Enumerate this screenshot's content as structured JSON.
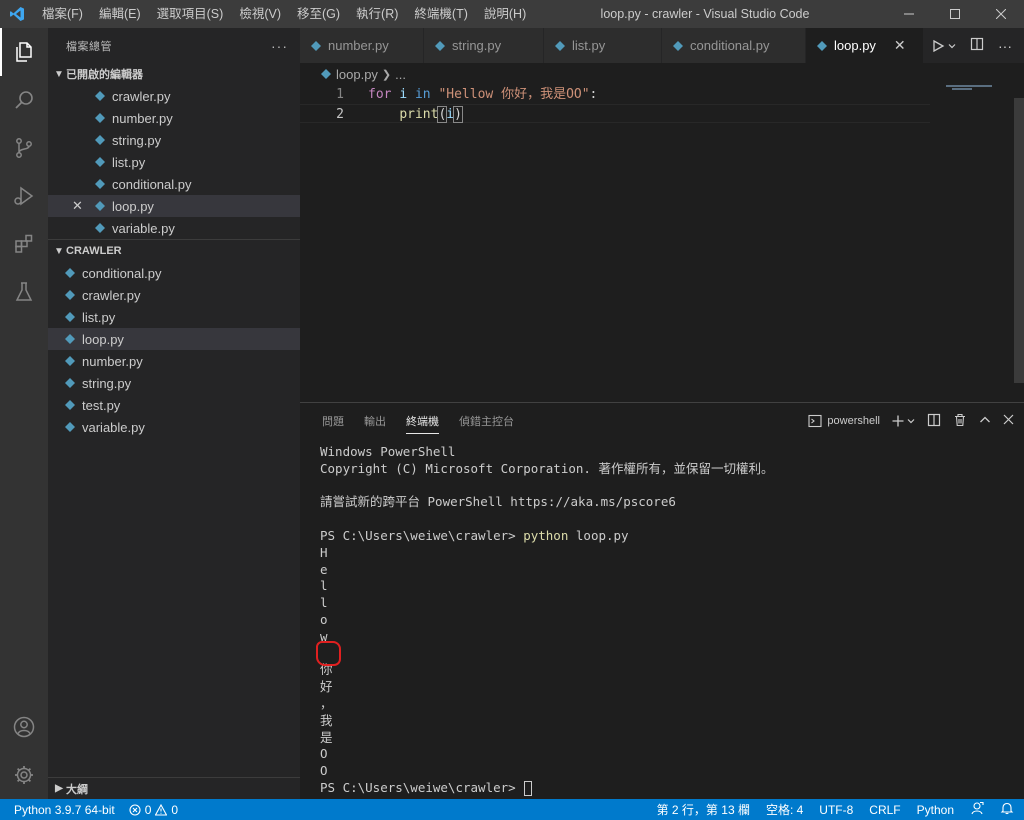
{
  "titlebar": {
    "menu": [
      "檔案(F)",
      "編輯(E)",
      "選取項目(S)",
      "檢視(V)",
      "移至(G)",
      "執行(R)",
      "終端機(T)",
      "說明(H)"
    ],
    "title": "loop.py - crawler - Visual Studio Code"
  },
  "sidebar": {
    "header": "檔案總管",
    "open_editors_title": "已開啟的編輯器",
    "open_editors": [
      "crawler.py",
      "number.py",
      "string.py",
      "list.py",
      "conditional.py",
      "loop.py",
      "variable.py"
    ],
    "folder_title": "CRAWLER",
    "folder_files": [
      "conditional.py",
      "crawler.py",
      "list.py",
      "loop.py",
      "number.py",
      "string.py",
      "test.py",
      "variable.py"
    ],
    "outline_title": "大綱"
  },
  "tabs": [
    "number.py",
    "string.py",
    "list.py",
    "conditional.py",
    "loop.py"
  ],
  "active_tab": "loop.py",
  "breadcrumb": {
    "file": "loop.py",
    "rest": "..."
  },
  "editor": {
    "line_numbers": [
      "1",
      "2"
    ],
    "line1": {
      "kw_for": "for",
      "var": "i",
      "kw_in": "in",
      "string": "\"Hellow 你好，我是OO\"",
      "colon": ":"
    },
    "line2": {
      "indent": "    ",
      "fn": "print",
      "open": "(",
      "arg": "i",
      "close": ")"
    }
  },
  "panel": {
    "tabs": [
      "問題",
      "輸出",
      "終端機",
      "偵錯主控台"
    ],
    "active_tab": "終端機",
    "shell": "powershell",
    "terminal_lines": [
      "Windows PowerShell",
      "Copyright (C) Microsoft Corporation. 著作權所有，並保留一切權利。",
      "",
      "請嘗試新的跨平台 PowerShell https://aka.ms/pscore6",
      ""
    ],
    "prompt": "PS C:\\Users\\weiwe\\crawler>",
    "command": "python",
    "command_args": "loop.py",
    "output_chars": [
      "H",
      "e",
      "l",
      "l",
      "o",
      "w",
      " ",
      "你",
      "好",
      "，",
      "我",
      "是",
      "O",
      "O"
    ],
    "final_prompt": "PS C:\\Users\\weiwe\\crawler>"
  },
  "statusbar": {
    "interpreter": "Python 3.9.7 64-bit",
    "errors": "0",
    "warnings": "0",
    "position": "第 2 行，第 13 欄",
    "spaces": "空格: 4",
    "encoding": "UTF-8",
    "eol": "CRLF",
    "language": "Python"
  },
  "colors": {
    "accent": "#007acc",
    "python_icon": "#519aba",
    "annotation": "#e02020"
  }
}
